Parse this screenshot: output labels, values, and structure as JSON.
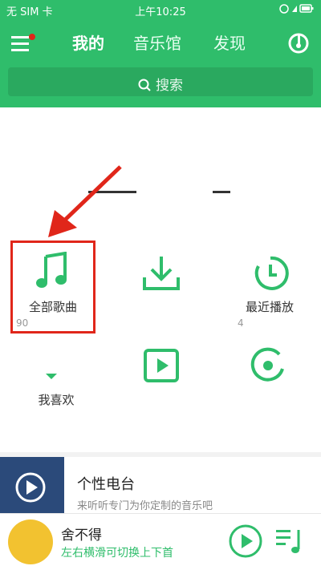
{
  "status_bar": {
    "carrier": "无 SIM 卡",
    "time": "上午10:25"
  },
  "header": {
    "tabs": [
      {
        "label": "我的"
      },
      {
        "label": "音乐馆"
      },
      {
        "label": "发现"
      }
    ],
    "search_label": "搜索"
  },
  "grid": {
    "all_songs": {
      "label": "全部歌曲",
      "count": "90"
    },
    "recent": {
      "label": "最近播放",
      "count": "4"
    },
    "favorite": {
      "label": "我喜欢"
    }
  },
  "radio": {
    "title": "个性电台",
    "subtitle": "来听听专门为你定制的音乐吧"
  },
  "player": {
    "title": "舍不得",
    "subtitle": "左右横滑可切换上下首"
  },
  "colors": {
    "accent": "#2fbd6b",
    "highlight": "#e0261a"
  }
}
